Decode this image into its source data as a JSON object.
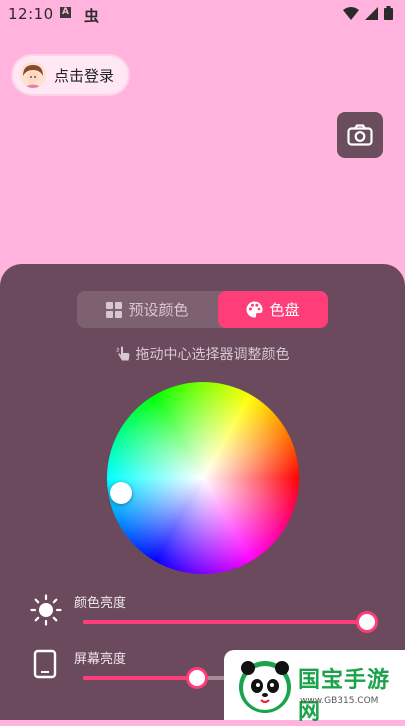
{
  "status_bar": {
    "time": "12:10",
    "a_glyph": "A",
    "bug_glyph": "虫"
  },
  "header": {
    "login_label": "点击登录"
  },
  "tabs": {
    "preset_label": "预设颜色",
    "wheel_label": "色盘",
    "active": "wheel"
  },
  "hint": "拖动中心选择器调整颜色",
  "sliders": {
    "color_brightness": {
      "label": "颜色亮度",
      "value_percent": 100
    },
    "screen_brightness": {
      "label": "屏幕亮度",
      "value_percent": 40
    }
  },
  "watermark": {
    "text": "国宝手游网",
    "url": "www.GB315.COM"
  },
  "colors": {
    "background": "#ffb3dd",
    "panel": "#6b4a5d",
    "accent": "#ff3d78"
  },
  "icons": [
    "signal-wifi-icon",
    "cell-signal-icon",
    "battery-icon",
    "camera-icon",
    "grid-icon",
    "palette-icon",
    "hand-pointer-icon",
    "sun-icon",
    "phone-icon",
    "panda-logo-icon"
  ]
}
